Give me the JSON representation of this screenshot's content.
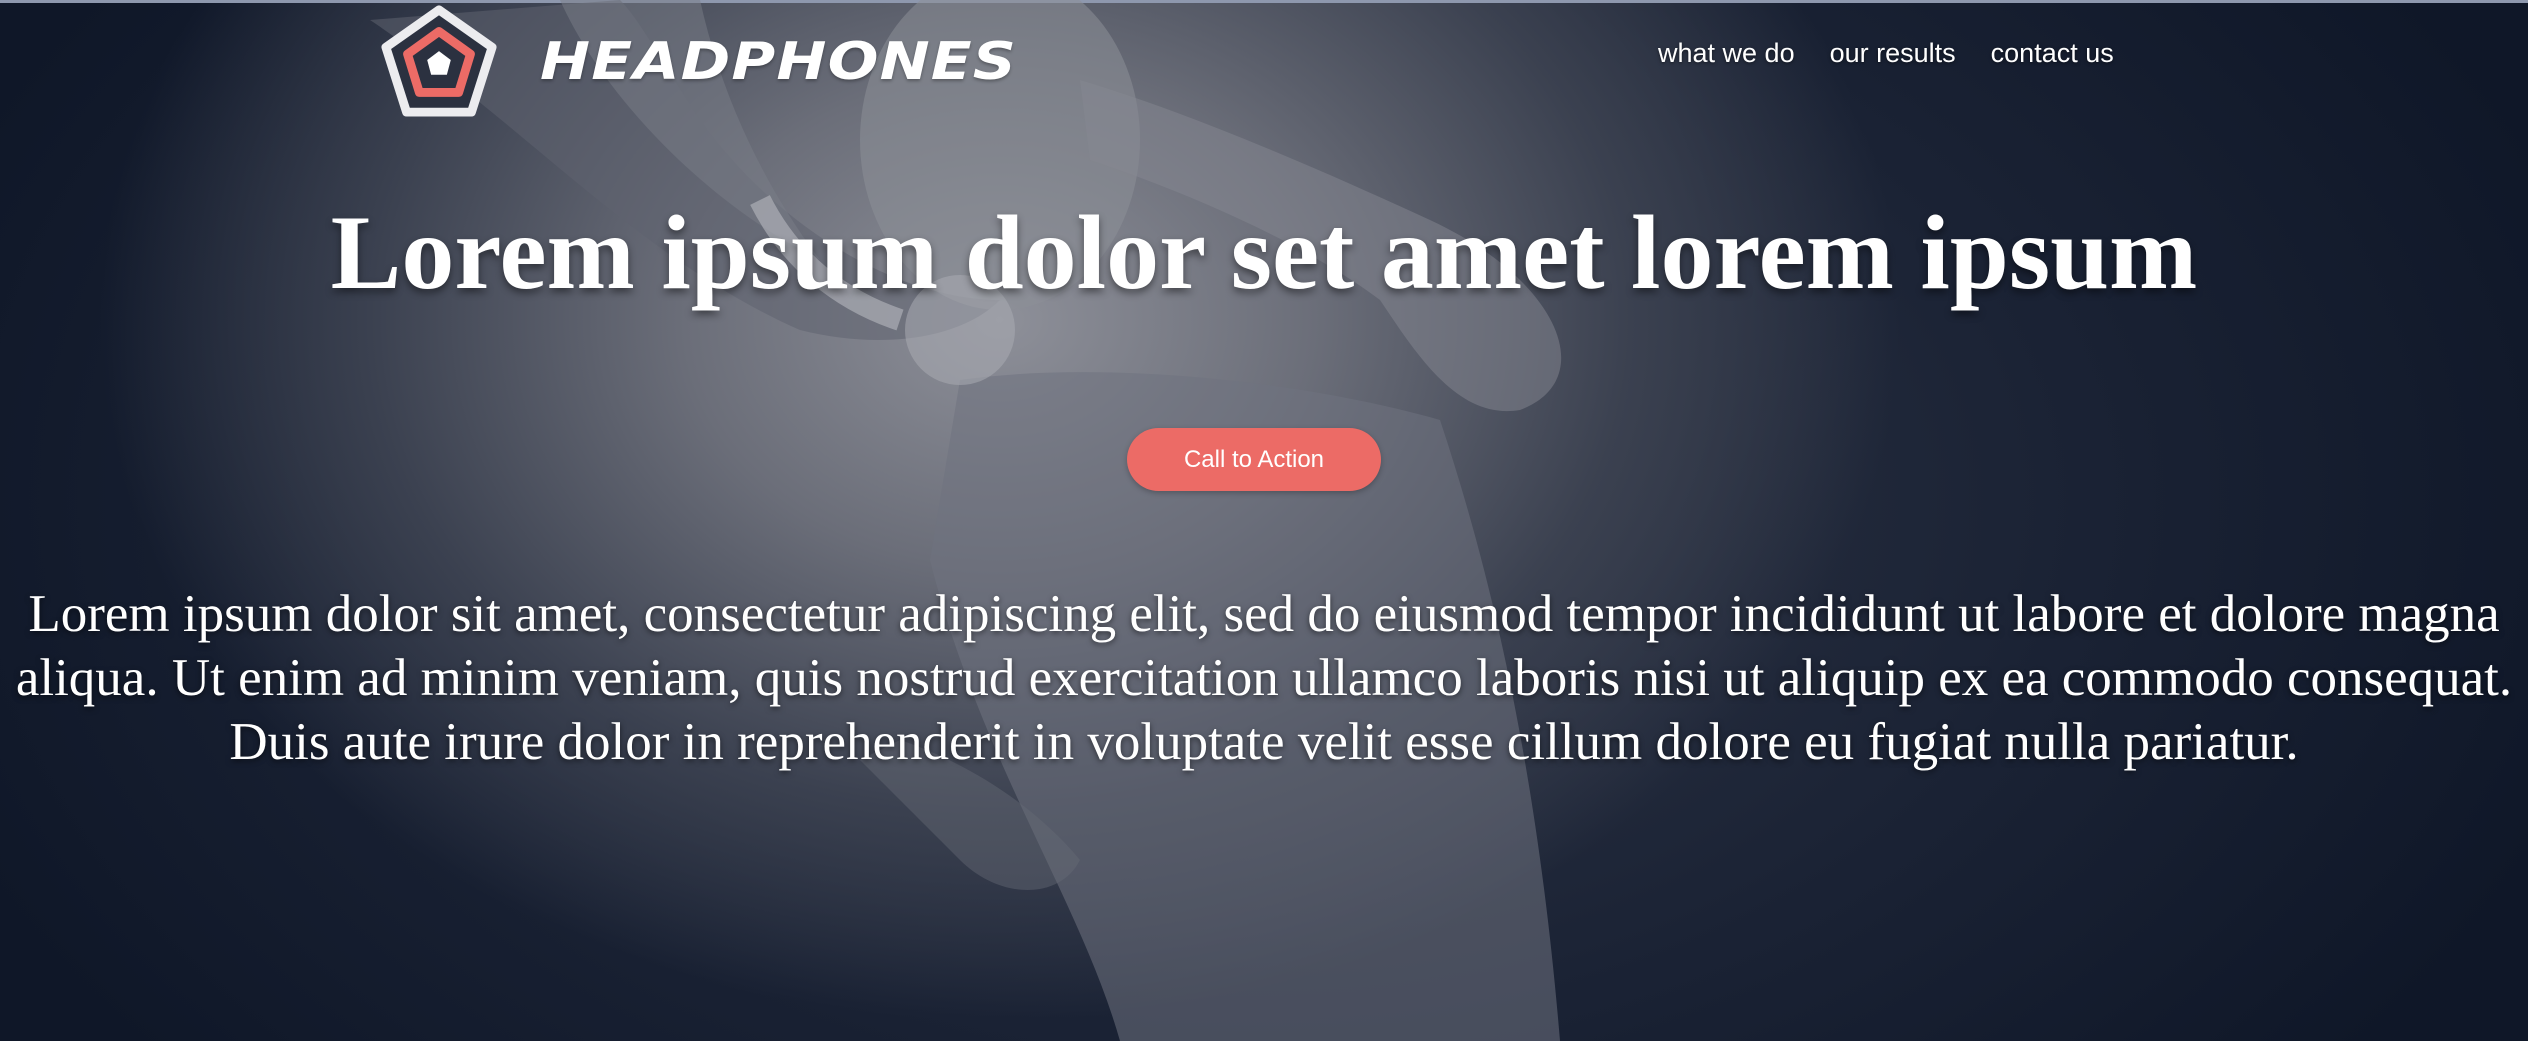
{
  "brand": {
    "name": "HEADPHONES",
    "logo_icon": "pentagon-logo-icon",
    "colors": {
      "accent": "#ec6b66",
      "logo_ring": "#e8e8ea",
      "background_dark": "#111a2c"
    }
  },
  "nav": {
    "items": [
      {
        "label": "what we do"
      },
      {
        "label": "our results"
      },
      {
        "label": "contact us"
      }
    ]
  },
  "hero": {
    "headline": "Lorem ipsum dolor set amet lorem ipsum",
    "cta_label": "Call to Action",
    "body": "Lorem ipsum dolor sit amet, consectetur adipiscing elit, sed do eiusmod tempor incididunt ut labore et dolore magna aliqua. Ut enim ad minim veniam, quis nostrud exercitation ullamco laboris nisi ut aliquip ex ea commodo consequat. Duis aute irure dolor in reprehenderit in voluptate velit esse cillum dolore eu fugiat nulla pariatur."
  }
}
